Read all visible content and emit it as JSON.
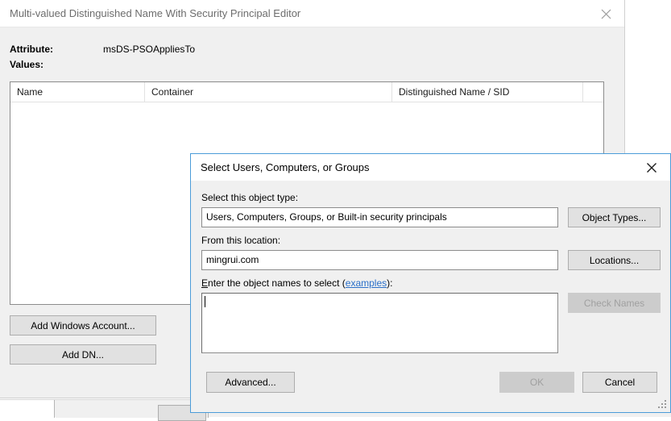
{
  "editor_window": {
    "title": "Multi-valued Distinguished Name With Security Principal Editor",
    "close_icon": "close-icon",
    "attribute_label": "Attribute:",
    "attribute_value": "msDS-PSOAppliesTo",
    "values_label": "Values:",
    "list": {
      "columns": [
        "Name",
        "Container",
        "Distinguished Name / SID",
        ""
      ],
      "rows": []
    },
    "buttons": {
      "add_windows_account": "Add Windows Account...",
      "add_dn": "Add DN..."
    }
  },
  "select_dialog": {
    "title": "Select Users, Computers, or Groups",
    "close_icon": "close-icon",
    "object_type_label": "Select this object type:",
    "object_type_value": "Users, Computers, Groups, or Built-in security principals",
    "object_types_button": "Object Types...",
    "location_label": "From this location:",
    "location_value": "mingrui.com",
    "locations_button": "Locations...",
    "enter_names_label_prefix": "E",
    "enter_names_label_mid": "nter the object names to select (",
    "enter_names_link": "examples",
    "enter_names_label_suffix": "):",
    "object_names_value": "",
    "check_names_button": "Check Names",
    "advanced_button": "Advanced...",
    "ok_button": "OK",
    "cancel_button": "Cancel",
    "resize_grip_icon": "resize-grip-icon"
  },
  "background_window": {
    "cut_off_text": "· · · · ·"
  },
  "colors": {
    "accent_border": "#4b9cd9",
    "link": "#2a6fc9",
    "window_bg": "#f0f0f0",
    "field_bg": "#ffffff",
    "button_bg": "#e1e1e1",
    "disabled_text": "#a0a0a0"
  }
}
